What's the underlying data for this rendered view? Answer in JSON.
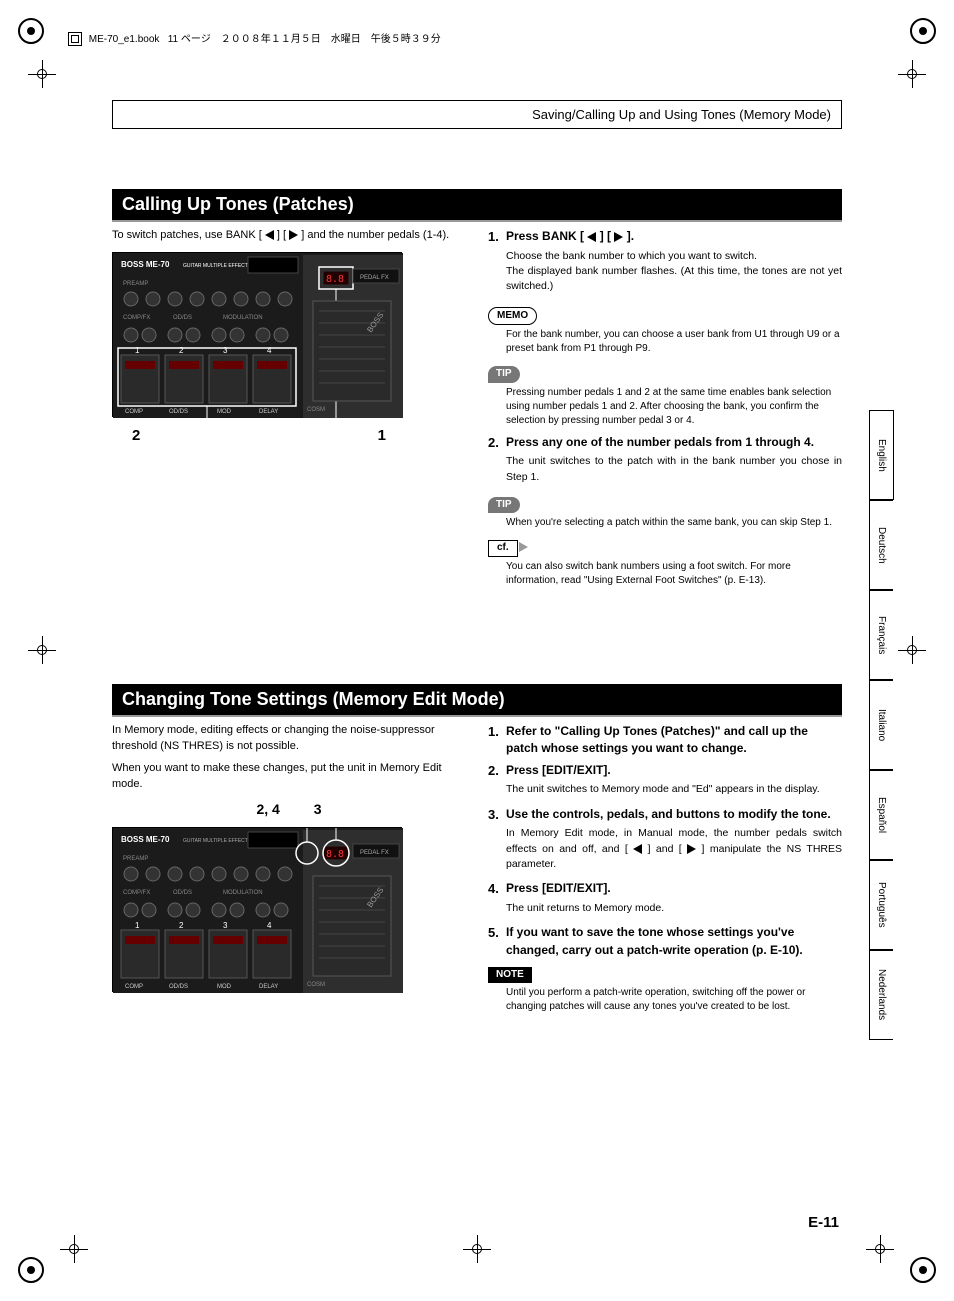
{
  "header": {
    "filename": "ME-70_e1.book",
    "page_meta": "11 ページ　２００８年１１月５日　水曜日　午後５時３９分"
  },
  "chapter_title": "Saving/Calling Up and Using Tones (Memory Mode)",
  "section1": {
    "title": "Calling Up Tones (Patches)",
    "intro_a": "To switch patches, use BANK [",
    "intro_b": "] [",
    "intro_c": "] and the number pedals (1-4).",
    "callout_left": "2",
    "callout_right": "1",
    "steps": [
      {
        "num": "1.",
        "title_a": "Press BANK [",
        "title_b": "] [",
        "title_c": "].",
        "body": "Choose the bank number to which you want to switch.\nThe displayed bank number flashes. (At this time, the tones are not yet switched.)"
      },
      {
        "num": "2.",
        "title": "Press any one of the number pedals from 1 through 4.",
        "body": "The unit switches to the patch with in the bank number you chose in Step 1."
      }
    ],
    "memo": {
      "label": "MEMO",
      "body": "For the bank number, you can choose a user bank from U1 through U9 or a preset bank from P1 through P9."
    },
    "tip1": {
      "label": "TIP",
      "body": "Pressing number pedals 1 and 2 at the same time enables bank selection using number pedals 1 and 2. After choosing the bank, you confirm the selection by pressing number pedal 3 or 4."
    },
    "tip2": {
      "label": "TIP",
      "body": "When you're selecting a patch within the same bank, you can skip Step 1."
    },
    "cf": {
      "label": "cf.",
      "body": "You can also switch bank numbers using a foot switch. For more information, read \"Using External Foot Switches\" (p. E-13)."
    }
  },
  "section2": {
    "title": "Changing Tone Settings (Memory Edit Mode)",
    "intro1": "In Memory mode, editing effects or changing the noise-suppressor threshold (NS THRES) is not possible.",
    "intro2": "When you want to make these changes, put the unit in Memory Edit mode.",
    "callout_left": "2, 4",
    "callout_right": "3",
    "steps": [
      {
        "num": "1.",
        "title": "Refer to \"Calling Up Tones (Patches)\" and call up the patch whose settings you want to change.",
        "body": ""
      },
      {
        "num": "2.",
        "title": "Press [EDIT/EXIT].",
        "body": "The unit switches to Memory mode and \"Ed\" appears in the display."
      },
      {
        "num": "3.",
        "title": "Use the controls, pedals, and buttons to modify the tone.",
        "body_a": "In Memory Edit mode, in Manual mode, the number pedals switch effects on and off, and [",
        "body_b": "] and [",
        "body_c": "] manipulate the NS THRES parameter."
      },
      {
        "num": "4.",
        "title": "Press [EDIT/EXIT].",
        "body": "The unit returns to Memory mode."
      },
      {
        "num": "5.",
        "title": "If you want to save the tone whose settings you've changed, carry out a patch-write operation (p. E-10).",
        "body": ""
      }
    ],
    "note": {
      "label": "NOTE",
      "body": "Until you perform a patch-write operation, switching off the power or changing patches will cause any tones you've created to be lost."
    }
  },
  "diagram": {
    "brand": "BOSS ME-70",
    "subbrand": "GUITAR MULTIPLE EFFECTS",
    "row_labels": [
      "PREAMP",
      "COMP/FX",
      "OD/DS",
      "MODULATION"
    ],
    "pedals": [
      "COMP",
      "OD/DS",
      "MOD",
      "DELAY"
    ],
    "pedal_nums": [
      "1",
      "2",
      "3",
      "4"
    ],
    "side": "BOSS",
    "cosm": "COSM",
    "display": "8.8",
    "pedal_label": "PEDAL FX"
  },
  "lang_tabs": [
    "English",
    "Deutsch",
    "Français",
    "Italiano",
    "Español",
    "Português",
    "Nederlands"
  ],
  "page_number": "E-11"
}
